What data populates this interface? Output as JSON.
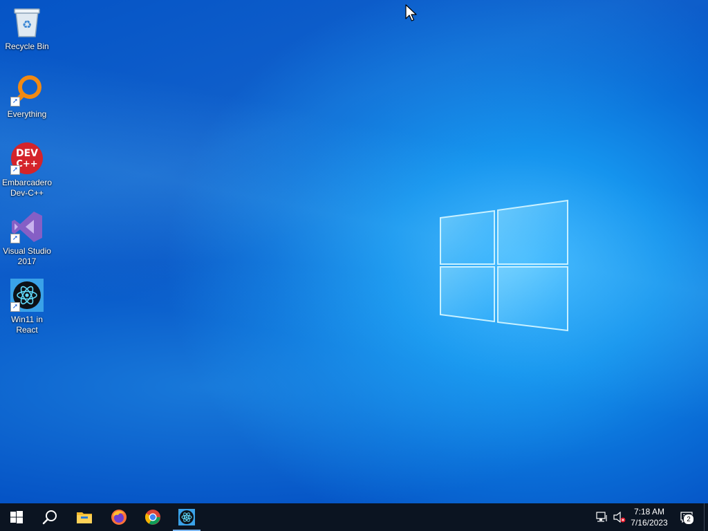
{
  "desktop": {
    "icons": [
      {
        "label": "Recycle Bin",
        "icon": "recycle-bin-icon"
      },
      {
        "label": "Everything",
        "icon": "everything-search-icon"
      },
      {
        "label": "Embarcadero\nDev-C++",
        "icon": "dev-cpp-icon",
        "badge_text": "DEV\nC++"
      },
      {
        "label": "Visual Studio\n2017",
        "icon": "visual-studio-icon"
      },
      {
        "label": "Win11 in\nReact",
        "icon": "react-app-icon"
      }
    ]
  },
  "taskbar": {
    "start": {
      "icon": "windows-start-icon"
    },
    "search": {
      "icon": "search-icon"
    },
    "pinned": [
      {
        "name": "File Explorer",
        "icon": "file-explorer-icon"
      },
      {
        "name": "Firefox",
        "icon": "firefox-icon"
      },
      {
        "name": "Chrome",
        "icon": "chrome-icon"
      },
      {
        "name": "Win11 in React",
        "icon": "react-app-icon",
        "active": true
      }
    ],
    "tray": {
      "network_icon": "network-icon",
      "volume_icon": "volume-muted-icon",
      "time": "7:18 AM",
      "date": "7/16/2023",
      "notifications_icon": "action-center-icon",
      "notification_count": "2"
    }
  },
  "colors": {
    "wallpaper_blue": "#1594ee",
    "taskbar": "#0b1421",
    "accent": "#7bb6ef"
  }
}
